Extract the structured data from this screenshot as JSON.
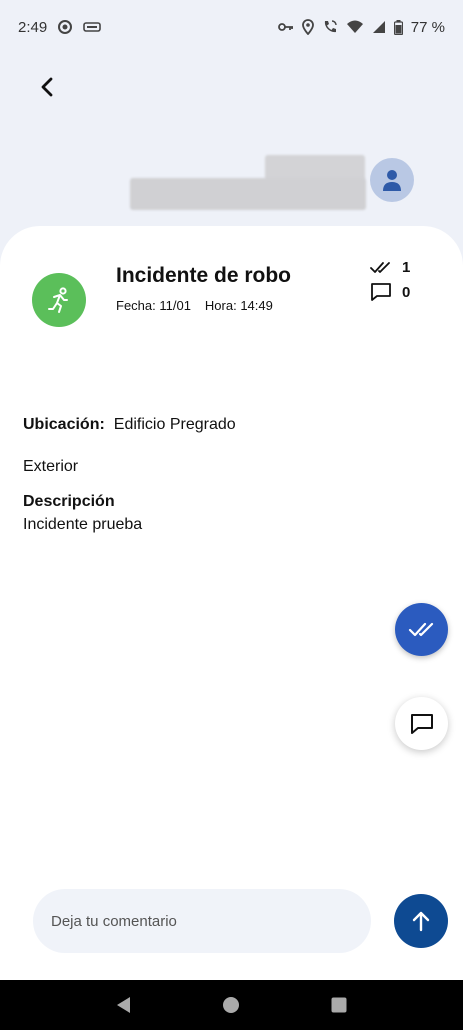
{
  "status_bar": {
    "time": "2:49",
    "battery": "77 %"
  },
  "incident": {
    "title": "Incidente de robo",
    "date": "Fecha: 11/01",
    "time": "Hora: 14:49",
    "checks_count": "1",
    "comments_count": "0",
    "icon": "running-person-icon",
    "icon_color": "#5bbf5a"
  },
  "details": {
    "location_label": "Ubicación:",
    "location_value": "Edificio Pregrado",
    "location_extra": "Exterior",
    "description_label": "Descripción",
    "description_value": "Incidente prueba"
  },
  "comment_box": {
    "placeholder": "Deja tu comentario"
  },
  "colors": {
    "background": "#eef1f8",
    "check_fab": "#2b5bbf",
    "send_button": "#0e4a92"
  }
}
